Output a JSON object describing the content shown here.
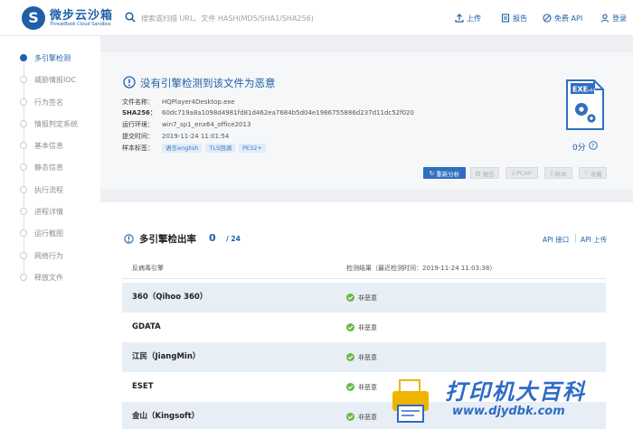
{
  "header": {
    "logo_title": "微步云沙箱",
    "logo_sub": "ThreatBook Cloud Sandbox",
    "search_placeholder": "搜索或扫描 URL、文件 HASH(MD5/SHA1/SHA256)",
    "nav": {
      "upload": "上传",
      "report": "报告",
      "free_api": "免费 API",
      "login": "登录"
    }
  },
  "sidebar": {
    "items": [
      {
        "label": "多引擎检测",
        "active": true
      },
      {
        "label": "威胁情报IOC"
      },
      {
        "label": "行为签名"
      },
      {
        "label": "情报判定系统"
      },
      {
        "label": "基本信息"
      },
      {
        "label": "静态信息"
      },
      {
        "label": "执行流程"
      },
      {
        "label": "进程详情"
      },
      {
        "label": "运行截图"
      },
      {
        "label": "网络行为"
      },
      {
        "label": "释放文件"
      }
    ]
  },
  "summary": {
    "verdict": "没有引擎检测到该文件为恶意",
    "file_name_label": "文件名称：",
    "file_name": "HQPlayer4Desktop.exe",
    "sha256_label": "SHA256：",
    "sha256": "60dc719a8a1098d4981fd81d462ea7684b5d04e1986755886d237d11dc52f020",
    "env_label": "运行环境：",
    "env": "win7_sp1_enx64_office2013",
    "submit_label": "提交时间：",
    "submit_time": "2019-11-24 11:01:54",
    "tags_label": "样本标签：",
    "tags": [
      "语言english",
      "TLS回调",
      "PE32+"
    ],
    "file_type": "EXE",
    "file_arch": "x64",
    "score": "0分",
    "actions": {
      "reanalyze": "重新分析",
      "report": "报告",
      "pcap": "PCAP",
      "sample": "样本",
      "favorite": "收藏"
    }
  },
  "engines": {
    "title": "多引擎检出率",
    "detected": "0",
    "total": "/ 24",
    "api_interface": "API 接口",
    "api_upload": "API 上传",
    "col_engine": "反病毒引擎",
    "col_result": "检测结果（最近检测时间：2019-11-24 11:03:38）",
    "rows": [
      {
        "name": "360（Qihoo 360）",
        "result": "非恶意"
      },
      {
        "name": "GDATA",
        "result": "非恶意"
      },
      {
        "name": "江民（JiangMin）",
        "result": "非恶意"
      },
      {
        "name": "ESET",
        "result": "非恶意"
      },
      {
        "name": "金山（Kingsoft）",
        "result": "非恶意"
      }
    ]
  },
  "watermark": {
    "main": "打印机大百科",
    "sub": "www.djydbk.com"
  },
  "colors": {
    "brand": "#1f5fa8",
    "safe": "#6cb944",
    "row_stripe": "#e8eef5"
  }
}
